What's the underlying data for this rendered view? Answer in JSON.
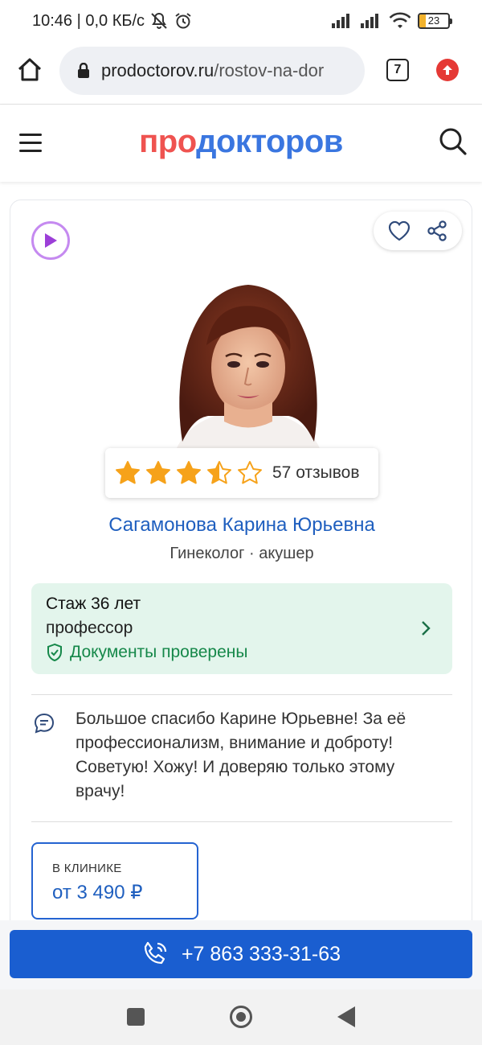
{
  "status_bar": {
    "time_net": "10:46 | 0,0 КБ/с",
    "battery": "23"
  },
  "browser": {
    "url_domain": "prodoctorov.ru",
    "url_path": "/rostov-na-dor",
    "tab_count": "7"
  },
  "site": {
    "logo_part1": "про",
    "logo_part2": "докторов",
    "brand_red": "#ef5350",
    "brand_blue": "#3a76e0"
  },
  "doctor": {
    "rating_stars": 3.5,
    "rating_max": 5,
    "reviews": "57 отзывов",
    "name": "Сагамонова Карина Юрьевна",
    "specialty": "Гинеколог · акушер",
    "experience": "Стаж 36 лет",
    "degree": "профессор",
    "verified": "Документы проверены",
    "review_text": "Большое спасибо Карине Юрьевне! За её профессионализм, внимание и доброту! Советую! Хожу! И доверяю только этому врачу!",
    "price_label": "В КЛИНИКЕ",
    "price_value": "от 3 490 ₽"
  },
  "call": {
    "phone": "+7 863 333-31-63"
  }
}
